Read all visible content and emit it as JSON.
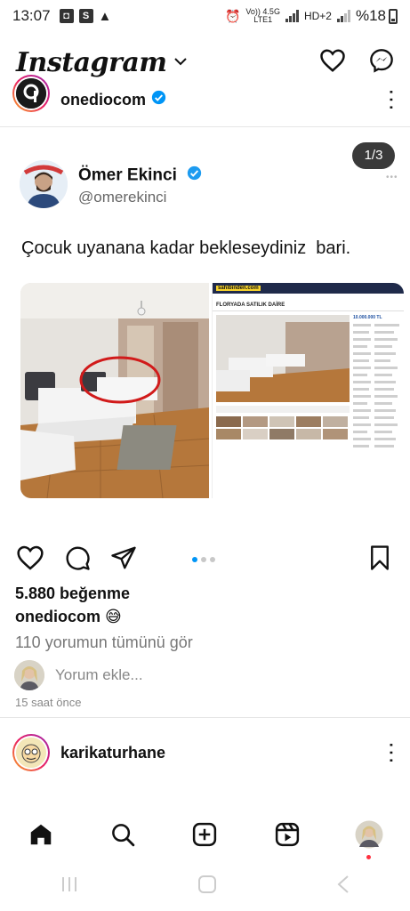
{
  "status_bar": {
    "time": "13:07",
    "network_top": "Vo)) 4.5G",
    "network_bottom": "LTE1",
    "network2": "HD+2",
    "battery": "%18"
  },
  "app": {
    "title": "Instagram"
  },
  "previous_post": {
    "username": "onediocom"
  },
  "post": {
    "image_counter": "1/3",
    "tweet": {
      "author_name": "Ömer Ekinci",
      "author_handle": "@omerekinci",
      "text": "Çocuk uyanana kadar bekleseydiniz  bari."
    },
    "listing": {
      "site": "sahibinden.com",
      "title": "FLORYADA SATILIK DAİRE",
      "price": "10.000.000 TL"
    },
    "likes": "5.880 beğenme",
    "caption_user": "onediocom",
    "caption_emoji": "😅",
    "view_comments": "110 yorumun tümünü gör",
    "add_comment_placeholder": "Yorum ekle...",
    "time_ago": "15 saat önce"
  },
  "next_post": {
    "username": "karikaturhane"
  },
  "colors": {
    "verified": "#0095f6",
    "accent_dot": "#0095f6",
    "notification": "#ff3040"
  }
}
